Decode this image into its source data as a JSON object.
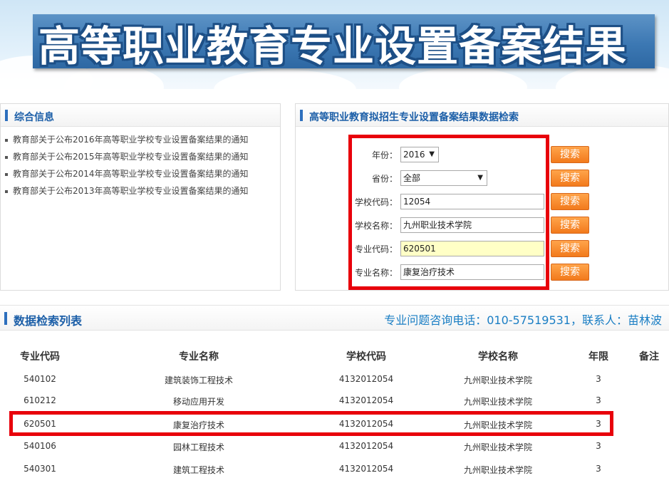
{
  "banner": {
    "title": "高等职业教育专业设置备案结果"
  },
  "info_panel": {
    "title": "综合信息",
    "items": [
      "教育部关于公布2016年高等职业学校专业设置备案结果的通知",
      "教育部关于公布2015年高等职业学校专业设置备案结果的通知",
      "教育部关于公布2014年高等职业学校专业设置备案结果的通知",
      "教育部关于公布2013年高等职业学校专业设置备案结果的通知"
    ]
  },
  "search_panel": {
    "title": "高等职业教育拟招生专业设置备案结果数据检索",
    "fields": [
      {
        "label": "年份：",
        "value": "2016",
        "type": "select"
      },
      {
        "label": "省份：",
        "value": "全部",
        "type": "select"
      },
      {
        "label": "学校代码：",
        "value": "12054",
        "type": "input"
      },
      {
        "label": "学校名称：",
        "value": "九州职业技术学院",
        "type": "input"
      },
      {
        "label": "专业代码：",
        "value": "620501",
        "type": "input"
      },
      {
        "label": "专业名称：",
        "value": "康复治疗技术",
        "type": "input"
      }
    ],
    "button_label": "搜索",
    "arrow": "▼"
  },
  "results": {
    "title": "数据检索列表",
    "contact": "专业问题咨询电话：010-57519531，联系人：苗林波",
    "columns": [
      "专业代码",
      "专业名称",
      "学校代码",
      "学校名称",
      "年限",
      "备注"
    ],
    "rows": [
      [
        "540102",
        "建筑装饰工程技术",
        "4132012054",
        "九州职业技术学院",
        "3",
        ""
      ],
      [
        "610212",
        "移动应用开发",
        "4132012054",
        "九州职业技术学院",
        "3",
        ""
      ],
      [
        "620501",
        "康复治疗技术",
        "4132012054",
        "九州职业技术学院",
        "3",
        ""
      ],
      [
        "540106",
        "园林工程技术",
        "4132012054",
        "九州职业技术学院",
        "3",
        ""
      ],
      [
        "540301",
        "建筑工程技术",
        "4132012054",
        "九州职业技术学院",
        "3",
        ""
      ]
    ]
  },
  "colors": {
    "accent": "#1c5fa8",
    "highlight": "#e8000b",
    "button": "#f27a1c"
  }
}
